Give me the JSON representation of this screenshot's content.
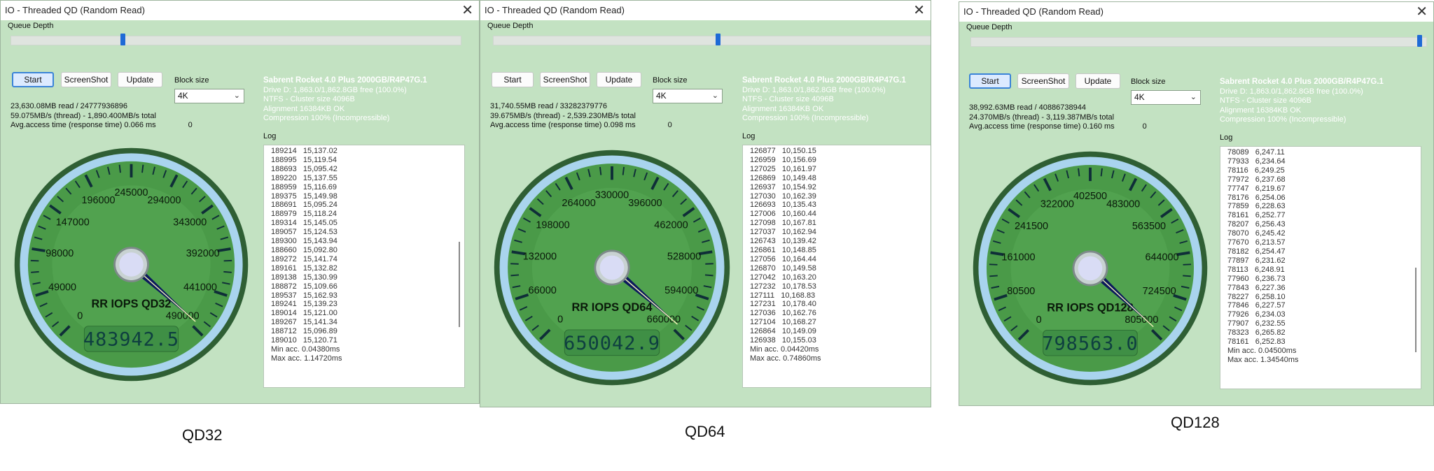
{
  "panels": [
    {
      "title": "IO - Threaded QD (Random Read)",
      "queue_depth_label": "Queue Depth",
      "queue_depth_fraction": 0.246,
      "buttons": {
        "start": "Start",
        "screenshot": "ScreenShot",
        "update": "Update"
      },
      "block_size_label": "Block size",
      "block_size_value": "4K",
      "stats": {
        "read": "23,630.08MB read / 24777936896",
        "throughput": "59.075MB/s (thread) - 1,890.400MB/s total",
        "access": "Avg.access time (response time) 0.066 ms",
        "zero": "0"
      },
      "drive": {
        "name": "Sabrent Rocket 4.0 Plus 2000GB/R4P47G.1",
        "free": "Drive D: 1,863.0/1,862.8GB free (100.0%)",
        "fs": "NTFS - Cluster size 4096B",
        "alignment": "Alignment 16384KB OK",
        "compression": "Compression 100% (Incompressible)"
      },
      "log_label": "Log",
      "log_entries": [
        "189214   15,137.02",
        "188995   15,119.54",
        "188693   15,095.42",
        "189220   15,137.55",
        "188959   15,116.69",
        "189375   15,149.98",
        "188691   15,095.24",
        "188979   15,118.24",
        "189314   15,145.05",
        "189057   15,124.53",
        "189300   15,143.94",
        "188660   15,092.80",
        "189272   15,141.74",
        "189161   15,132.82",
        "189138   15,130.99",
        "188872   15,109.66",
        "189537   15,162.93",
        "189241   15,139.23",
        "189014   15,121.00",
        "189267   15,141.34",
        "188712   15,096.89",
        "189010   15,120.71",
        "Min acc. 0.04380ms",
        "Max acc. 1.14720ms"
      ],
      "log_scroll_fraction": 0.62,
      "gauge": {
        "ticks": [
          "0",
          "49000",
          "98000",
          "147000",
          "196000",
          "245000",
          "294000",
          "343000",
          "392000",
          "441000",
          "490000"
        ],
        "max": 490000,
        "value": 483942.5,
        "label": "RR IOPS QD32",
        "digital": "483942.5"
      },
      "caption": "QD32"
    },
    {
      "title": "IO - Threaded QD (Random Read)",
      "queue_depth_label": "Queue Depth",
      "queue_depth_fraction": 0.5,
      "buttons": {
        "start": "Start",
        "screenshot": "ScreenShot",
        "update": "Update"
      },
      "block_size_label": "Block size",
      "block_size_value": "4K",
      "stats": {
        "read": "31,740.55MB read / 33282379776",
        "throughput": "39.675MB/s (thread) - 2,539.230MB/s total",
        "access": "Avg.access time (response time) 0.098 ms",
        "zero": "0"
      },
      "drive": {
        "name": "Sabrent Rocket 4.0 Plus 2000GB/R4P47G.1",
        "free": "Drive D: 1,863.0/1,862.8GB free (100.0%)",
        "fs": "NTFS - Cluster size 4096B",
        "alignment": "Alignment 16384KB OK",
        "compression": "Compression 100% (Incompressible)"
      },
      "log_label": "Log",
      "log_entries": [
        "126877   10,150.15",
        "126959   10,156.69",
        "127025   10,161.97",
        "126869   10,149.48",
        "126937   10,154.92",
        "127030   10,162.39",
        "126693   10,135.43",
        "127006   10,160.44",
        "127098   10,167.81",
        "127037   10,162.94",
        "126743   10,139.42",
        "126861   10,148.85",
        "127056   10,164.44",
        "126870   10,149.58",
        "127042   10,163.20",
        "127232   10,178.53",
        "127111   10,168.83",
        "127231   10,178.40",
        "127036   10,162.76",
        "127104   10,168.27",
        "126864   10,149.09",
        "126938   10,155.03",
        "Min acc. 0.04420ms",
        "Max acc. 0.74860ms"
      ],
      "log_scroll_fraction": 0.66,
      "gauge": {
        "ticks": [
          "0",
          "66000",
          "132000",
          "198000",
          "264000",
          "330000",
          "396000",
          "462000",
          "528000",
          "594000",
          "660000"
        ],
        "max": 660000,
        "value": 650042.9,
        "label": "RR IOPS QD64",
        "digital": "650042.9"
      },
      "caption": "QD64"
    },
    {
      "title": "IO - Threaded QD (Random Read)",
      "queue_depth_label": "Queue Depth",
      "queue_depth_fraction": 0.99,
      "buttons": {
        "start": "Start",
        "screenshot": "ScreenShot",
        "update": "Update"
      },
      "block_size_label": "Block size",
      "block_size_value": "4K",
      "stats": {
        "read": "38,992.63MB read / 40886738944",
        "throughput": "24.370MB/s (thread) - 3,119.387MB/s total",
        "access": "Avg.access time (response time) 0.160 ms",
        "zero": "0"
      },
      "drive": {
        "name": "Sabrent Rocket 4.0 Plus 2000GB/R4P47G.1",
        "free": "Drive D: 1,863.0/1,862.8GB free (100.0%)",
        "fs": "NTFS - Cluster size 4096B",
        "alignment": "Alignment 16384KB OK",
        "compression": "Compression 100% (Incompressible)"
      },
      "log_label": "Log",
      "log_entries": [
        "78089   6,247.11",
        "77933   6,234.64",
        "78116   6,249.25",
        "77972   6,237.68",
        "77747   6,219.67",
        "78176   6,254.06",
        "77859   6,228.63",
        "78161   6,252.77",
        "78207   6,256.43",
        "78070   6,245.42",
        "77670   6,213.57",
        "78182   6,254.47",
        "77897   6,231.62",
        "78113   6,248.91",
        "77960   6,236.73",
        "77843   6,227.36",
        "78227   6,258.10",
        "77846   6,227.57",
        "77926   6,234.03",
        "77907   6,232.55",
        "78323   6,265.82",
        "78161   6,252.83",
        "Min acc. 0.04500ms",
        "Max acc. 1.34540ms"
      ],
      "log_scroll_fraction": 0.78,
      "gauge": {
        "ticks": [
          "0",
          "80500",
          "161000",
          "241500",
          "322000",
          "402500",
          "483000",
          "563500",
          "644000",
          "724500",
          "805000"
        ],
        "max": 805000,
        "value": 798563.0,
        "label": "RR IOPS QD128",
        "digital": "798563.0"
      },
      "caption": "QD128"
    }
  ]
}
